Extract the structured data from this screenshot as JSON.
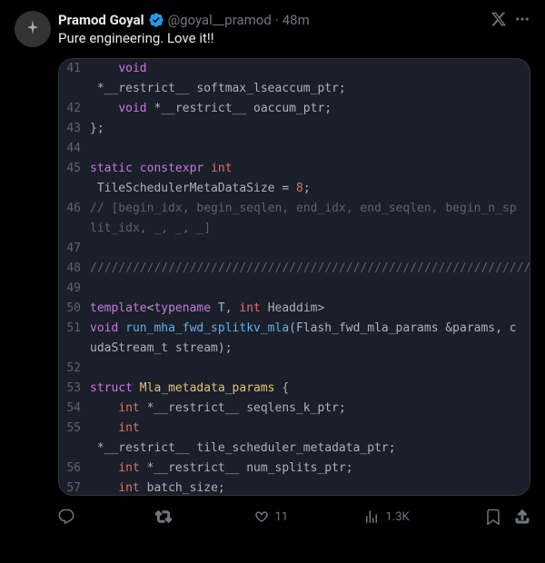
{
  "tweet": {
    "display_name": "Pramod Goyal",
    "handle": "@goyal__pramod",
    "separator": "·",
    "time": "48m",
    "text": "Pure engineering. Love it!!",
    "source_label": "x",
    "actions": {
      "replies": "",
      "retweets": "",
      "likes": "11",
      "views": "1.3K"
    }
  },
  "code": {
    "lines": [
      {
        "n": "41",
        "segs": [
          [
            "    ",
            "d"
          ],
          [
            "void",
            "k"
          ]
        ]
      },
      {
        "n": "",
        "segs": [
          [
            " *__restrict__ softmax_lseaccum_ptr;",
            "i"
          ]
        ]
      },
      {
        "n": "42",
        "segs": [
          [
            "    ",
            "d"
          ],
          [
            "void",
            "k"
          ],
          [
            " *__restrict__ oaccum_ptr;",
            "i"
          ]
        ]
      },
      {
        "n": "43",
        "segs": [
          [
            "};",
            "i"
          ]
        ]
      },
      {
        "n": "44",
        "segs": [
          [
            "",
            "d"
          ]
        ]
      },
      {
        "n": "45",
        "segs": [
          [
            "static constexpr ",
            "k"
          ],
          [
            "int",
            "t"
          ]
        ]
      },
      {
        "n": "",
        "segs": [
          [
            " TileSchedulerMetaDataSize = ",
            "i"
          ],
          [
            "8",
            "t"
          ],
          [
            ";",
            "i"
          ]
        ]
      },
      {
        "n": "46",
        "segs": [
          [
            "// [begin_idx, begin_seqlen, end_idx, end_seqlen, begin_n_split_idx, _, _, _]",
            "c"
          ]
        ]
      },
      {
        "n": "47",
        "segs": [
          [
            "",
            "d"
          ]
        ]
      },
      {
        "n": "48",
        "segs": [
          [
            "/////////////////////////////////////////////////////////////////////////////////////////////////////",
            "c"
          ]
        ]
      },
      {
        "n": "49",
        "segs": [
          [
            "",
            "d"
          ]
        ]
      },
      {
        "n": "50",
        "segs": [
          [
            "template",
            "k"
          ],
          [
            "<",
            "i"
          ],
          [
            "typename",
            "k"
          ],
          [
            " T, ",
            "i"
          ],
          [
            "int",
            "t"
          ],
          [
            " Headdim>",
            "i"
          ]
        ]
      },
      {
        "n": "51",
        "segs": [
          [
            "void ",
            "k"
          ],
          [
            "run_mha_fwd_splitkv_mla",
            "f"
          ],
          [
            "(Flash_fwd_mla_params &params, cudaStream_t stream);",
            "i"
          ]
        ]
      },
      {
        "n": "52",
        "segs": [
          [
            "",
            "d"
          ]
        ]
      },
      {
        "n": "53",
        "segs": [
          [
            "struct ",
            "k"
          ],
          [
            "Mla_metadata_params",
            "cls"
          ],
          [
            " {",
            "i"
          ]
        ]
      },
      {
        "n": "54",
        "segs": [
          [
            "    ",
            "d"
          ],
          [
            "int",
            "t"
          ],
          [
            " *__restrict__ seqlens_k_ptr;",
            "i"
          ]
        ]
      },
      {
        "n": "55",
        "segs": [
          [
            "    ",
            "d"
          ],
          [
            "int",
            "t"
          ]
        ]
      },
      {
        "n": "",
        "segs": [
          [
            " *__restrict__ tile_scheduler_metadata_ptr;",
            "i"
          ]
        ]
      },
      {
        "n": "56",
        "segs": [
          [
            "    ",
            "d"
          ],
          [
            "int",
            "t"
          ],
          [
            " *__restrict__ num_splits_ptr;",
            "i"
          ]
        ]
      },
      {
        "n": "57",
        "segs": [
          [
            "    ",
            "d"
          ],
          [
            "int",
            "t"
          ],
          [
            " batch_size;",
            "i"
          ]
        ]
      }
    ]
  }
}
